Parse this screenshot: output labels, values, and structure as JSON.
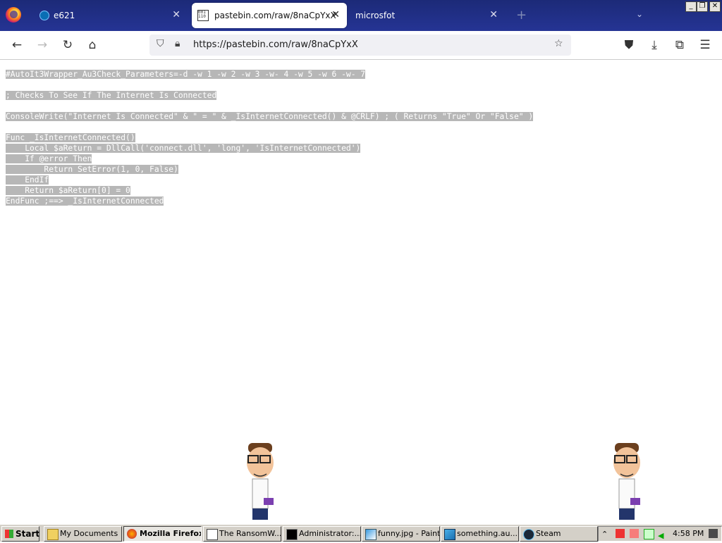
{
  "browser": {
    "tabs": [
      {
        "label": "e621"
      },
      {
        "label": "pastebin.com/raw/8naCpYxX",
        "active": true
      },
      {
        "label": "microsfot"
      }
    ],
    "new_tab": "+",
    "url": "https://pastebin.com/raw/8naCpYxX",
    "window_controls": {
      "minimize": "_",
      "maximize": "❐",
      "close": "✕"
    }
  },
  "code": {
    "lines": [
      "#AutoIt3Wrapper_Au3Check_Parameters=-d -w 1 -w 2 -w 3 -w- 4 -w 5 -w 6 -w- 7",
      "",
      "; Checks To See If The Internet Is Connected",
      "",
      "ConsoleWrite(\"Internet Is Connected\" & \" = \" & _IsInternetConnected() & @CRLF) ; ( Returns \"True\" Or \"False\" )",
      "",
      "Func _IsInternetConnected()",
      "    Local $aReturn = DllCall('connect.dll', 'long', 'IsInternetConnected')",
      "    If @error Then",
      "        Return SetError(1, 0, False)",
      "    EndIf",
      "    Return $aReturn[0] = 0",
      "EndFunc ;==> _IsInternetConnected"
    ]
  },
  "taskbar": {
    "start": "Start",
    "items": [
      {
        "label": "My Documents",
        "icon": "folder-icon"
      },
      {
        "label": "Mozilla Firefox",
        "icon": "firefox-icon",
        "active": true
      },
      {
        "label": "The RansomW...",
        "icon": "window-icon"
      },
      {
        "label": "Administrator:...",
        "icon": "console-icon"
      },
      {
        "label": "funny.jpg - Paint",
        "icon": "paint-icon"
      },
      {
        "label": "something.au...",
        "icon": "script-icon"
      },
      {
        "label": "Steam",
        "icon": "steam-icon"
      }
    ],
    "clock": "4:58 PM"
  },
  "colors": {
    "tabstrip": "#1c2a78",
    "selection": "#b7b7b7",
    "taskbar": "#d4d0c8"
  }
}
